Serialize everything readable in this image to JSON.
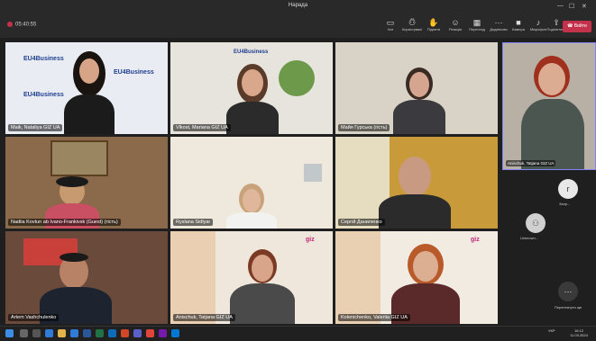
{
  "window": {
    "title": "Нарада"
  },
  "toolbar": {
    "timer": "05:40:55",
    "items": [
      {
        "label": "Чат",
        "icon": "chat-icon"
      },
      {
        "label": "Користувачі",
        "icon": "people-icon"
      },
      {
        "label": "Підняти",
        "icon": "raise-hand-icon"
      },
      {
        "label": "Реакція",
        "icon": "reaction-icon"
      },
      {
        "label": "Перегляд",
        "icon": "view-icon"
      },
      {
        "label": "Додатково",
        "icon": "more-icon"
      },
      {
        "label": "Камера",
        "icon": "camera-icon"
      },
      {
        "label": "Мікрофон",
        "icon": "mic-icon"
      },
      {
        "label": "Поділитися",
        "icon": "share-icon"
      }
    ],
    "participants_count": "23",
    "leave_label": "Вийти"
  },
  "tiles": [
    {
      "name": "Maik, Nataliya GIZ UA",
      "bg": "#e9ecf3"
    },
    {
      "name": "Vlkost, Mariana GIZ UA",
      "bg": "#e7e4de"
    },
    {
      "name": "Майя Гурська (гість)",
      "bg": "#d9d2c6"
    },
    {
      "name": "Nadiia Kovtun ab Ivano-Frankivsk (Guest) (гість)",
      "bg": "#8a6a4a"
    },
    {
      "name": "Ryslana Sidlyar",
      "bg": "#efe8dc"
    },
    {
      "name": "Сергій Даниленко",
      "bg": "#c89a3a"
    },
    {
      "name": "Artem Vashchulenko",
      "bg": "#6a4a3a"
    },
    {
      "name": "Anischuk, Tatjana GIZ UA",
      "bg": "#efe6dc"
    },
    {
      "name": "Kolenichenko, Valeriia GIZ UA",
      "bg": "#f1ebe2"
    }
  ],
  "backdrop_text": "EU4Business",
  "spotlight": {
    "name": "Anischuk, Tatjana GIZ UA"
  },
  "side_participants": [
    {
      "initial": "r",
      "label": "Запр..."
    },
    {
      "initial": "",
      "label": "Unknown..."
    }
  ],
  "more_participants_label": "Переглянути ще",
  "clock": {
    "time": "16:12",
    "date": "11.03.2024",
    "lang": "УКР"
  }
}
